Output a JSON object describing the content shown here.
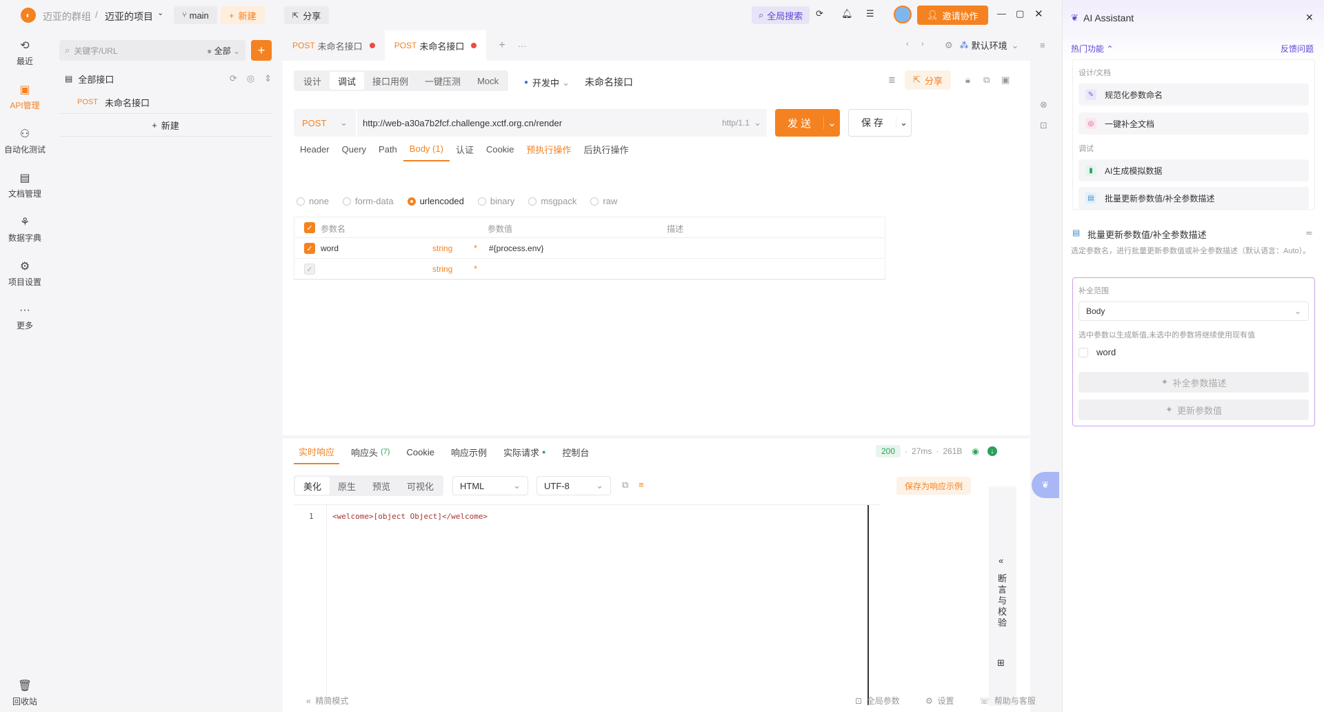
{
  "topbar": {
    "team": "迈亚的群组",
    "project": "迈亚的项目",
    "branch": "main",
    "new_label": "新建",
    "share_label": "分享",
    "global_search": "全局搜索",
    "invite": "邀请协作"
  },
  "leftnav": [
    {
      "label": "最近",
      "icon": "history-icon"
    },
    {
      "label": "API管理",
      "icon": "api-icon"
    },
    {
      "label": "自动化测试",
      "icon": "automation-icon"
    },
    {
      "label": "文档管理",
      "icon": "document-icon"
    },
    {
      "label": "数据字典",
      "icon": "dictionary-icon"
    },
    {
      "label": "项目设置",
      "icon": "settings-icon"
    },
    {
      "label": "更多",
      "icon": "more-icon"
    }
  ],
  "leftnav_bottom": "回收站",
  "tree": {
    "search_placeholder": "关键字/URL",
    "filter": "全部",
    "root": "全部接口",
    "item_method": "POST",
    "item_name": "未命名接口",
    "new_label": "新建"
  },
  "doctabs": [
    {
      "method": "POST",
      "name": "未命名接口"
    },
    {
      "method": "POST",
      "name": "未命名接口"
    }
  ],
  "env": "默认环境",
  "modes": [
    "设计",
    "调试",
    "接口用例",
    "一键压测",
    "Mock"
  ],
  "status": "开发中",
  "api_name": "未命名接口",
  "share": "分享",
  "request": {
    "method": "POST",
    "url": "http://web-a30a7b2fcf.challenge.xctf.org.cn/render",
    "protocol": "http/1.1",
    "send": "发 送",
    "save": "保 存"
  },
  "req_tabs": [
    "Header",
    "Query",
    "Path",
    "Body (1)",
    "认证",
    "Cookie",
    "预执行操作",
    "后执行操作"
  ],
  "body_types": [
    "none",
    "form-data",
    "urlencoded",
    "binary",
    "msgpack",
    "raw"
  ],
  "param_headers": {
    "name": "参数名",
    "value": "参数值",
    "desc": "描述"
  },
  "params": [
    {
      "name": "word",
      "type": "string",
      "value": "#{process.env}"
    },
    {
      "name": "",
      "type": "string",
      "value": ""
    }
  ],
  "resp_tabs": [
    "实时响应",
    "响应头",
    "Cookie",
    "响应示例",
    "实际请求",
    "控制台"
  ],
  "resp_header_count": "(7)",
  "resp_meta": {
    "status": "200",
    "time": "27ms",
    "size": "261B"
  },
  "resp_views": [
    "美化",
    "原生",
    "预览",
    "可视化"
  ],
  "resp_format": "HTML",
  "resp_encoding": "UTF-8",
  "save_example": "保存为响应示例",
  "code_line_no": "1",
  "code_line": "<welcome>[object Object]</welcome>",
  "assert_panel": "断言与校验",
  "footer": {
    "left": "精简模式",
    "global_params": "全局参数",
    "settings": "设置",
    "help": "帮助与客服"
  },
  "ai": {
    "title": "AI Assistant",
    "hot": "热门功能",
    "feedback": "反馈问题",
    "group1": "设计/文档",
    "items1": [
      "规范化参数命名",
      "一键补全文档"
    ],
    "group2": "调试",
    "items2": [
      "AI生成模拟数据",
      "批量更新参数值/补全参数描述"
    ],
    "feature_title": "批量更新参数值/补全参数描述",
    "feature_desc": "选定参数名，进行批量更新参数值或补全参数描述（默认语言：Auto）。",
    "scope_label": "补全范围",
    "scope_value": "Body",
    "hint": "选中参数以生成新值,未选中的参数将继续使用现有值",
    "param": "word",
    "btn_desc": "补全参数描述",
    "btn_update": "更新参数值"
  }
}
